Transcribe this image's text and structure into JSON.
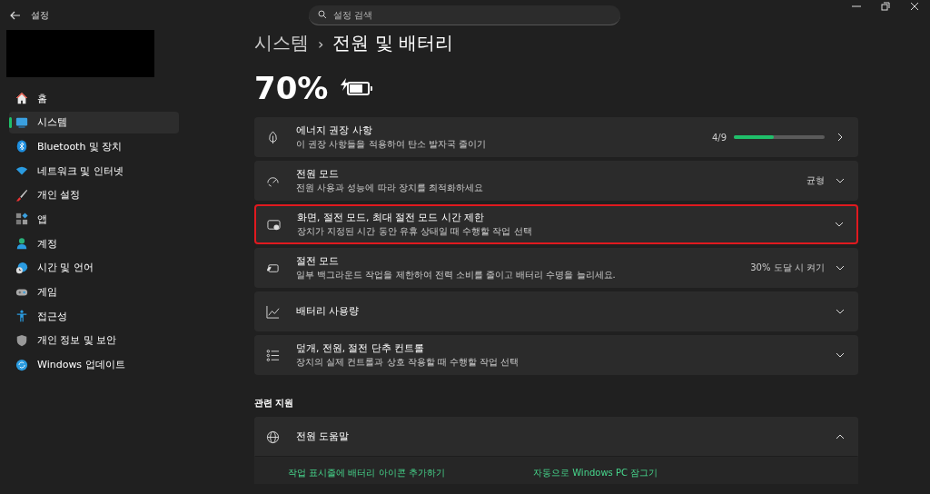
{
  "window": {
    "title": "설정"
  },
  "search": {
    "placeholder": "설정 검색"
  },
  "sidebar": {
    "items": [
      {
        "label": "홈",
        "selected": false
      },
      {
        "label": "시스템",
        "selected": true
      },
      {
        "label": "Bluetooth 및 장치",
        "selected": false
      },
      {
        "label": "네트워크 및 인터넷",
        "selected": false
      },
      {
        "label": "개인 설정",
        "selected": false
      },
      {
        "label": "앱",
        "selected": false
      },
      {
        "label": "계정",
        "selected": false
      },
      {
        "label": "시간 및 언어",
        "selected": false
      },
      {
        "label": "게임",
        "selected": false
      },
      {
        "label": "접근성",
        "selected": false
      },
      {
        "label": "개인 정보 및 보안",
        "selected": false
      },
      {
        "label": "Windows 업데이트",
        "selected": false
      }
    ]
  },
  "breadcrumb": {
    "parent": "시스템",
    "separator": "›",
    "current": "전원 및 배터리"
  },
  "battery": {
    "percent": "70%",
    "charging": true,
    "level": 0.7
  },
  "cards": [
    {
      "kind": "link",
      "title": "에너지 권장 사항",
      "subtitle": "이 권장 사항들을 적용하여 탄소 발자국 줄이기",
      "value": "4/9",
      "level": 0.44,
      "highlighted": false
    },
    {
      "kind": "expander",
      "title": "전원 모드",
      "subtitle": "전원 사용과 성능에 따라 장치를 최적화하세요",
      "value": "균형",
      "highlighted": false
    },
    {
      "kind": "expander",
      "title": "화면, 절전 모드, 최대 절전 모드 시간 제한",
      "subtitle": "장치가 지정된 시간 동안 유휴 상태일 때 수행할 작업 선택",
      "highlighted": true
    },
    {
      "kind": "expander",
      "title": "절전 모드",
      "subtitle": "일부 백그라운드 작업을 제한하여 전력 소비를 줄이고 배터리 수명을 늘리세요.",
      "value": "30% 도달 시 켜기",
      "highlighted": false
    },
    {
      "kind": "expander",
      "title": "배터리 사용량",
      "highlighted": false
    },
    {
      "kind": "expander",
      "title": "덮개, 전원, 절전 단추 컨트롤",
      "subtitle": "장치의 실제 컨트롤과 상호 작용할 때 수행할 작업 선택",
      "highlighted": false
    }
  ],
  "related": {
    "heading": "관련 지원",
    "title": "전원 도움말",
    "expanded": true,
    "links": [
      "작업 표시줄에 배터리 아이콘 추가하기",
      "자동으로 Windows PC 잠그기"
    ]
  }
}
